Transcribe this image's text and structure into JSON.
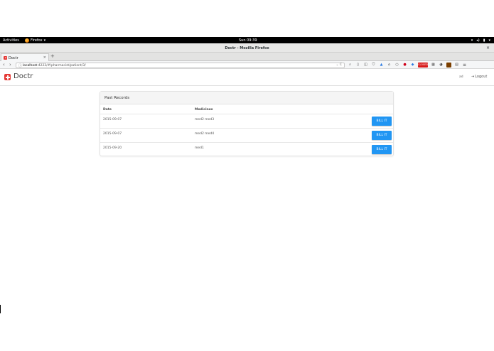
{
  "system": {
    "activities": "Activities",
    "app_name": "Firefox",
    "app_arrow": "▾",
    "clock": "Sun 09:39",
    "tray_icons": [
      "network-icon",
      "volume-icon",
      "battery-icon",
      "power-menu-icon"
    ]
  },
  "window": {
    "title": "Doctr - Mozilla Firefox",
    "close": "×"
  },
  "browser": {
    "tab_label": "Doctr",
    "tab_close": "×",
    "new_tab": "+",
    "back": "‹",
    "forward": "›",
    "url_host": "localhost",
    "url_path": ":4223/#/pharmacist/patient/3/",
    "url_right": "⌄ C",
    "extension_badge": "CLOSED"
  },
  "app": {
    "brand": "Doctr",
    "user": "ad",
    "logout": "Logout",
    "accent_color": "#e53935",
    "button_color": "#2196f3"
  },
  "records": {
    "heading": "Past Records",
    "col_date": "Date",
    "col_medicines": "Medicines",
    "rows": [
      {
        "date": "2015-09-07",
        "medicines": "med2 med3",
        "action": "BILL IT"
      },
      {
        "date": "2015-09-07",
        "medicines": "med2 med4",
        "action": "BILL IT"
      },
      {
        "date": "2015-09-20",
        "medicines": "med1",
        "action": "BILL IT"
      }
    ]
  }
}
